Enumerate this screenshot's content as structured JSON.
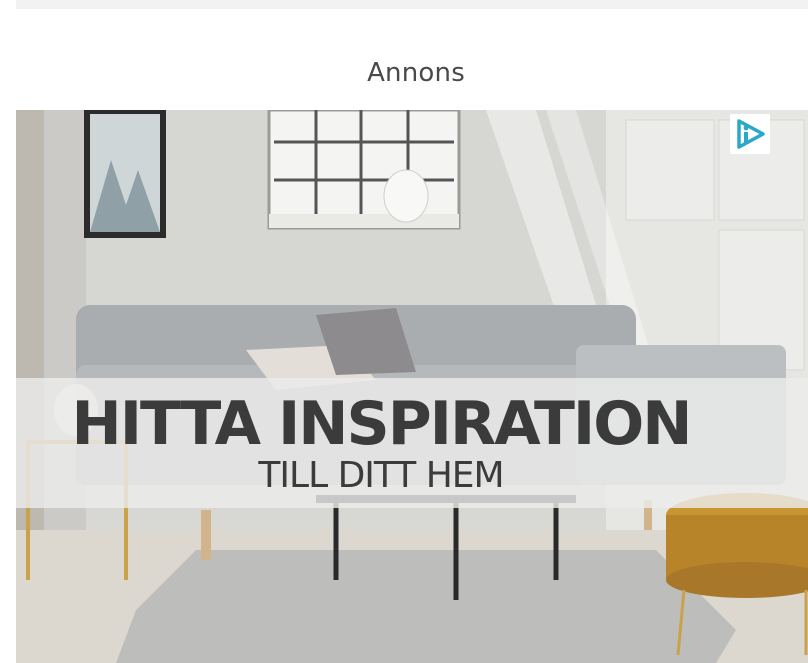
{
  "ad": {
    "label": "Annons",
    "headline": "HITTA INSPIRATION",
    "subheadline": "TILL DITT HEM",
    "adchoices_icon": "adchoices-icon",
    "accent_color": "#2aa7c9"
  }
}
